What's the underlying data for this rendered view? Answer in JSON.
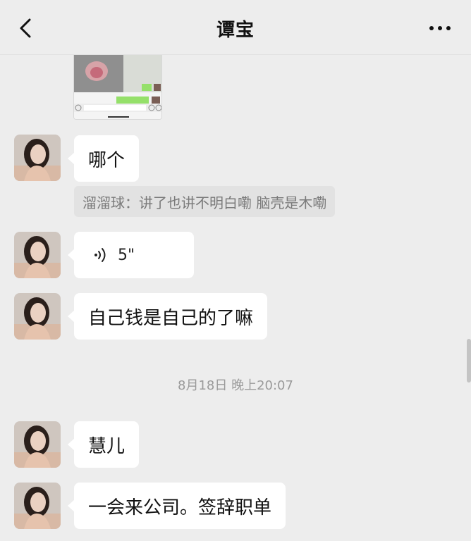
{
  "header": {
    "title": "谭宝",
    "back_icon": "chevron-left-icon",
    "more_icon": "more-dots-icon"
  },
  "messages": [
    {
      "type": "image"
    },
    {
      "type": "text",
      "text": "哪个"
    },
    {
      "type": "quote",
      "text": "溜溜球：讲了也讲不明白嘞 脑壳是木嘞"
    },
    {
      "type": "voice",
      "duration": "5\"",
      "icon": "voice-wave-icon"
    },
    {
      "type": "text",
      "text": "自己钱是自己的了嘛"
    },
    {
      "type": "timestamp",
      "text": "8月18日 晚上20:07"
    },
    {
      "type": "text",
      "text": "慧儿"
    },
    {
      "type": "text",
      "text": "一会来公司。签辞职单"
    }
  ],
  "colors": {
    "background": "#ededed",
    "bubble": "#ffffff",
    "quote_bg": "#e2e2e2",
    "quote_text": "#7a7a7a",
    "timestamp_text": "#9a9a9a"
  }
}
